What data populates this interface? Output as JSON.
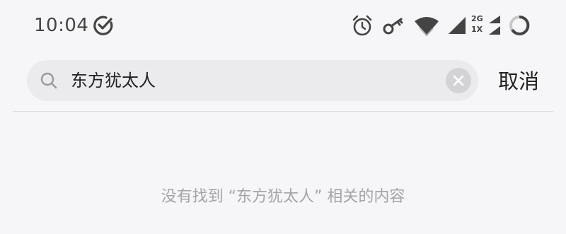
{
  "status_bar": {
    "time": "10:04",
    "icons": [
      "check-circle-icon",
      "alarm-icon",
      "key-icon",
      "wifi-icon",
      "signal-icon",
      "signal-2g-icon",
      "battery-ring-icon"
    ],
    "network_top": "2G",
    "network_bottom": "1X"
  },
  "search": {
    "query": "东方犹太人",
    "search_icon": "search-icon",
    "clear_icon": "clear-icon"
  },
  "header": {
    "cancel_label": "取消"
  },
  "results": {
    "empty_message": "没有找到 “东方犹太人” 相关的内容"
  },
  "colors": {
    "background": "#f6f6f8",
    "search_box": "#ebebed",
    "muted_text": "#a4a4a8"
  }
}
